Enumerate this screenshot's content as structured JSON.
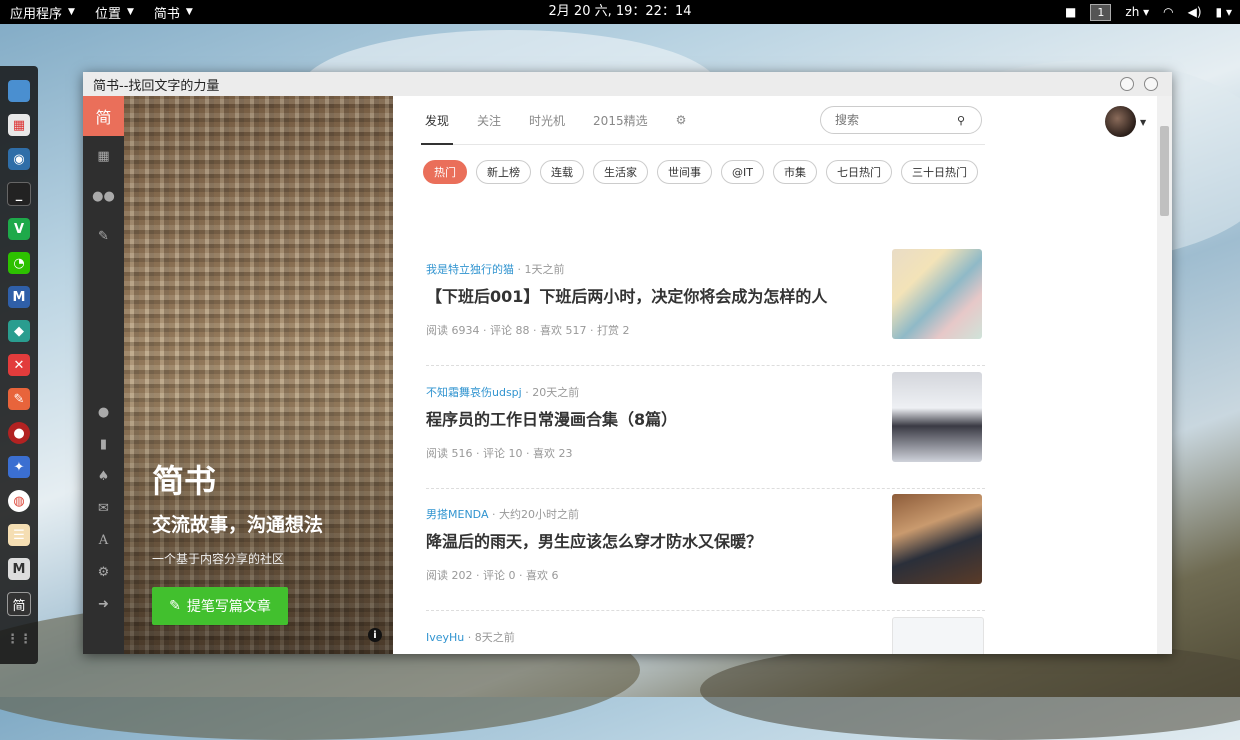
{
  "topbar": {
    "apps": "应用程序",
    "places": "位置",
    "active_app": "简书",
    "clock": "2月 20 六, 19：22：14",
    "workspace": "1",
    "lang": "zh"
  },
  "window": {
    "title": "简书--找回文字的力量"
  },
  "nav": {
    "logo": "简"
  },
  "hero": {
    "title": "简书",
    "slogan": "交流故事，沟通想法",
    "subtitle": "一个基于内容分享的社区",
    "write_button": "提笔写篇文章"
  },
  "tabs": [
    "发现",
    "关注",
    "时光机",
    "2015精选"
  ],
  "search": {
    "placeholder": "搜索"
  },
  "categories": [
    "热门",
    "新上榜",
    "连载",
    "生活家",
    "世间事",
    "@IT",
    "市集",
    "七日热门",
    "三十日热门"
  ],
  "articles": [
    {
      "author": "我是特立独行的猫",
      "time": "1天之前",
      "title": "【下班后001】下班后两小时，决定你将会成为怎样的人",
      "stats": "阅读 6934 · 评论 88 · 喜欢 517 · 打赏 2"
    },
    {
      "author": "不知霜舞哀伤udspj",
      "time": "20天之前",
      "title": "程序员的工作日常漫画合集（8篇）",
      "stats": "阅读 516 · 评论 10 · 喜欢 23"
    },
    {
      "author": "男搭MENDA",
      "time": "大约20小时之前",
      "title": "降温后的雨天，男生应该怎么穿才防水又保暖？",
      "stats": "阅读 202 · 评论 0 · 喜欢 6"
    },
    {
      "author": "IveyHu",
      "time": "8天之前",
      "title": "",
      "stats": ""
    }
  ],
  "colors": {
    "brand": "#ea6f5a",
    "write_button": "#42c02e",
    "author_link": "#3194d0"
  }
}
